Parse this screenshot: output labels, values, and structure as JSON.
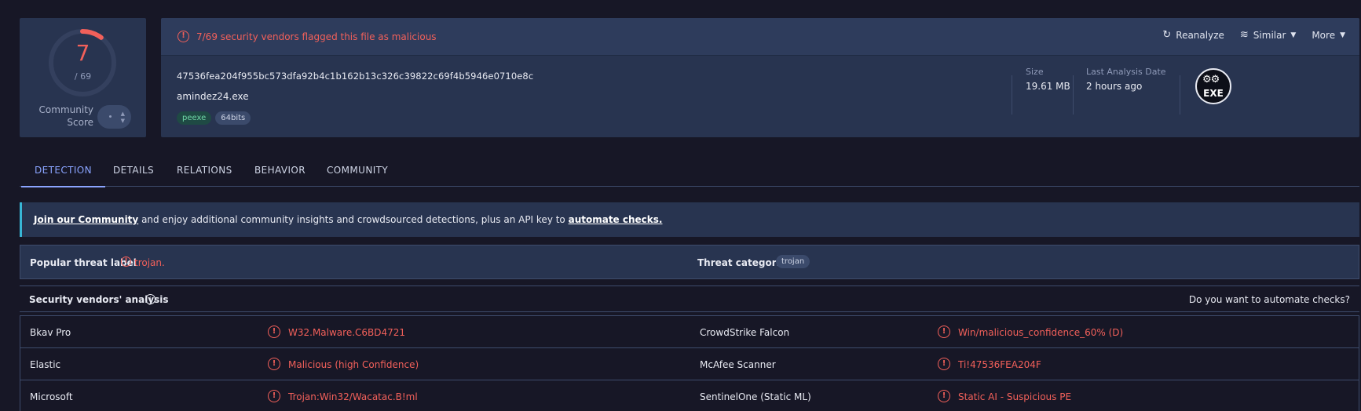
{
  "score": {
    "detections": "7",
    "total": "/ 69",
    "community_label_line1": "Community",
    "community_label_line2": "Score",
    "gauge_fraction": 0.1014
  },
  "header": {
    "flag_text": "7/69 security vendors flagged this file as malicious",
    "actions": [
      {
        "label": "Reanalyze",
        "icon": "refresh-icon"
      },
      {
        "label": "Similar",
        "icon": "similar-icon"
      },
      {
        "label": "More"
      }
    ]
  },
  "file": {
    "hash": "47536fea204f955bc573dfa92b4c1b162b13c326c39822c69f4b5946e0710e8c",
    "name": "amindez24.exe",
    "tags": [
      "peexe",
      "64bits"
    ],
    "size_label": "Size",
    "size_value": "19.61 MB",
    "date_label": "Last Analysis Date",
    "date_value": "2 hours ago",
    "type_icon_text": "EXE"
  },
  "tabs": [
    "DETECTION",
    "DETAILS",
    "RELATIONS",
    "BEHAVIOR",
    "COMMUNITY"
  ],
  "banner": {
    "link1": "Join our Community",
    "middle": " and enjoy additional community insights and crowdsourced detections, plus an API key to ",
    "link2": "automate checks."
  },
  "threat": {
    "popular_label": "Popular threat label",
    "popular_value": "trojan.",
    "categories_label": "Threat categories",
    "categories_value": "trojan"
  },
  "analysis": {
    "title": "Security vendors' analysis",
    "automate_prompt": "Do you want to automate checks?"
  },
  "vendors": [
    [
      {
        "vendor": "Bkav Pro",
        "result": "W32.Malware.C6BD4721"
      },
      {
        "vendor": "CrowdStrike Falcon",
        "result": "Win/malicious_confidence_60% (D)"
      }
    ],
    [
      {
        "vendor": "Elastic",
        "result": "Malicious (high Confidence)"
      },
      {
        "vendor": "McAfee Scanner",
        "result": "Ti!47536FEA204F"
      }
    ],
    [
      {
        "vendor": "Microsoft",
        "result": "Trojan:Win32/Wacatac.B!ml"
      },
      {
        "vendor": "SentinelOne (Static ML)",
        "result": "Static AI - Suspicious PE"
      }
    ]
  ],
  "colors": {
    "malicious": "#f2605a",
    "accent": "#8aa4ff",
    "card": "#283450",
    "background": "#171726"
  }
}
